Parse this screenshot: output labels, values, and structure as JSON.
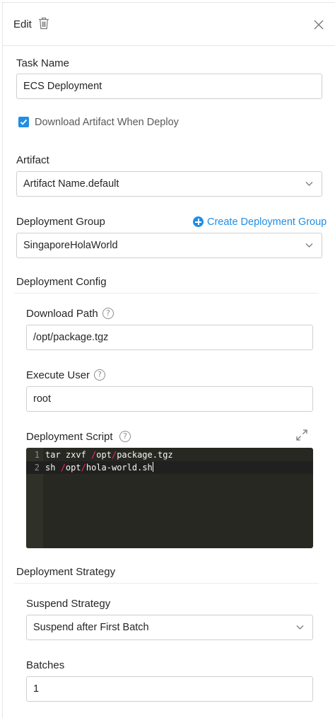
{
  "header": {
    "title": "Edit"
  },
  "task_name": {
    "label": "Task Name",
    "value": "ECS Deployment"
  },
  "download_artifact": {
    "label": "Download Artifact When Deploy",
    "checked": true
  },
  "artifact": {
    "label": "Artifact",
    "value": "Artifact Name.default"
  },
  "deployment_group": {
    "label": "Deployment Group",
    "create_link": "Create Deployment Group",
    "value": "SingaporeHolaWorld"
  },
  "deployment_config": {
    "title": "Deployment Config",
    "download_path": {
      "label": "Download Path",
      "value": "/opt/package.tgz"
    },
    "execute_user": {
      "label": "Execute User",
      "value": "root"
    },
    "deployment_script": {
      "label": "Deployment Script",
      "lines": [
        {
          "number": "1",
          "text": "tar zxvf /opt/package.tgz"
        },
        {
          "number": "2",
          "text": "sh /opt/hola-world.sh"
        }
      ]
    }
  },
  "deployment_strategy": {
    "title": "Deployment Strategy",
    "suspend_strategy": {
      "label": "Suspend Strategy",
      "value": "Suspend after First Batch"
    },
    "batches": {
      "label": "Batches",
      "value": "1"
    }
  },
  "colors": {
    "accent": "#1f8ee6",
    "editor_bg": "#272822",
    "border": "#cfcfcf"
  },
  "icons": [
    "trash-icon",
    "close-icon",
    "check-icon",
    "chevron-down-icon",
    "plus-circle-icon",
    "help-icon",
    "expand-icon"
  ]
}
